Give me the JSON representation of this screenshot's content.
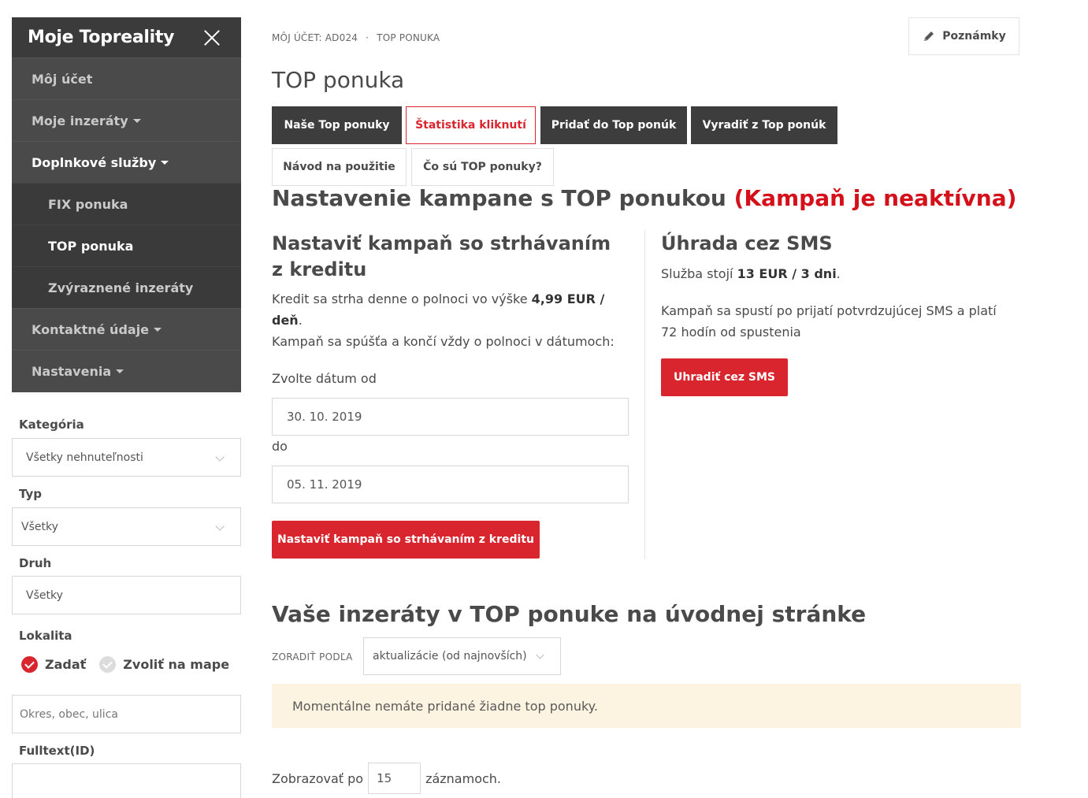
{
  "sidebar": {
    "title": "Moje Topreality",
    "items": [
      {
        "label": "Môj účet"
      },
      {
        "label": "Moje inzeráty"
      },
      {
        "label": "Doplnkové služby"
      },
      {
        "label": "FIX ponuka"
      },
      {
        "label": "TOP ponuka"
      },
      {
        "label": "Zvýraznené inzeráty"
      },
      {
        "label": "Kontaktné údaje"
      },
      {
        "label": "Nastavenia"
      }
    ]
  },
  "filters": {
    "category_label": "Kategória",
    "category_value": "Všetky nehnuteľnosti",
    "type_label": "Typ",
    "type_value": "Všetky",
    "kind_label": "Druh",
    "kind_value": "Všetky",
    "locality_label": "Lokalita",
    "locality_option_enter": "Zadať",
    "locality_option_map": "Zvoliť na mape",
    "locality_placeholder": "Okres, obec, ulica",
    "fulltext_label": "Fulltext(ID)"
  },
  "breadcrumb": {
    "account": "MÔJ ÚČET: AD024",
    "separator": "·",
    "current": "TOP PONUKA"
  },
  "notes_button": "Poznámky",
  "page_title": "TOP ponuka",
  "tabs": [
    {
      "label": "Naše Top ponuky"
    },
    {
      "label": "Štatistika kliknutí"
    },
    {
      "label": "Pridať do Top ponúk"
    },
    {
      "label": "Vyradiť z Top ponúk"
    },
    {
      "label": "Návod na použitie"
    },
    {
      "label": "Čo sú TOP ponuky?"
    }
  ],
  "campaign": {
    "heading": "Nastavenie kampane s TOP ponukou",
    "status": "(Kampaň je neaktívna)",
    "credit": {
      "heading": "Nastaviť kampaň so strhávaním z kreditu",
      "line1_prefix": "Kredit sa strha denne o polnoci vo výške",
      "line1_amount": "4,99 EUR / deň",
      "line1_suffix": ".",
      "line2": "Kampaň sa spúšťa a končí vždy o polnoci v dátumoch:",
      "date_from_label": "Zvolte dátum od",
      "date_from": "30. 10. 2019",
      "date_to_label": "do",
      "date_to": "05. 11. 2019",
      "button": "Nastaviť kampaň so strhávaním z kreditu"
    },
    "sms": {
      "heading": "Úhrada cez SMS",
      "price_prefix": "Služba stojí",
      "price": "13 EUR / 3 dni",
      "price_suffix": ".",
      "info": "Kampaň sa spustí po prijatí potvrdzujúcej SMS a platí 72 hodín od spustenia",
      "button": "Uhradiť cez SMS"
    }
  },
  "listing": {
    "heading": "Vaše inzeráty v TOP ponuke na úvodnej stránke",
    "sort_label": "ZORADIŤ PODĽA",
    "sort_value": "aktualizácie (od najnovších)",
    "empty_message": "Momentálne nemáte pridané žiadne top ponuky.",
    "per_page_prefix": "Zobrazovať po",
    "per_page_value": "15",
    "per_page_suffix": "záznamoch."
  },
  "colors": {
    "accent_red": "#d9262e",
    "sidebar_bg": "#4a4a4a",
    "alert_bg": "#fcf3e1"
  }
}
